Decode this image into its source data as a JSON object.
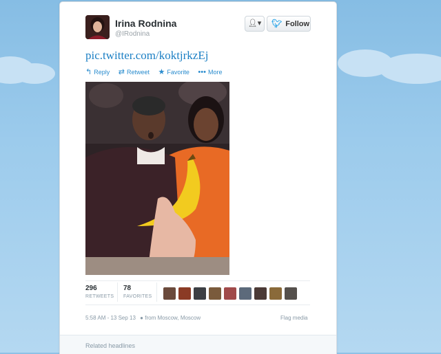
{
  "tweet": {
    "author_name": "Irina Rodnina",
    "author_handle": "@IRodnina",
    "user_menu_label": "▾",
    "follow_label": "Follow",
    "link_text": "pic.twitter.com/koktjrkzEj",
    "actions": {
      "reply": "Reply",
      "retweet": "Retweet",
      "favorite": "Favorite",
      "more": "More"
    },
    "stats": {
      "retweets_count": "296",
      "retweets_label": "RETWEETS",
      "favorites_count": "78",
      "favorites_label": "FAVORITES"
    },
    "timestamp": "5:58 AM - 13 Sep 13",
    "location": "from Moscow, Moscow",
    "flag_label": "Flag media",
    "related_label": "Related headlines"
  },
  "colors": {
    "link": "#1b7fc4",
    "action": "#2a8cce",
    "follow_bird": "#2ea6e8",
    "background": "#8ec1e6"
  },
  "icons": [
    "reply-icon",
    "retweet-icon",
    "star-icon",
    "more-icon",
    "twitter-bird-icon",
    "location-pin-icon",
    "person-icon"
  ]
}
